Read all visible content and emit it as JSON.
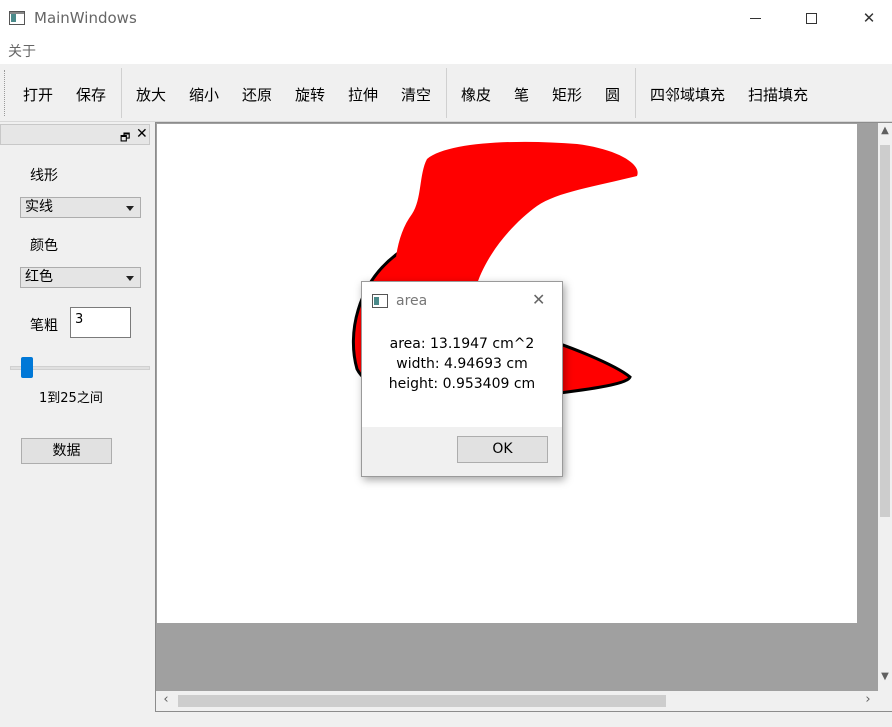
{
  "window": {
    "title": "MainWindows"
  },
  "menu": {
    "about": "关于"
  },
  "toolbar": {
    "open": "打开",
    "save": "保存",
    "zoom_in": "放大",
    "zoom_out": "缩小",
    "restore": "还原",
    "rotate": "旋转",
    "stretch": "拉伸",
    "clear": "清空",
    "eraser": "橡皮",
    "pen": "笔",
    "rect": "矩形",
    "circle": "圆",
    "fill4": "四邻域填充",
    "scan_fill": "扫描填充"
  },
  "dock": {
    "line_style_label": "线形",
    "line_style_value": "实线",
    "color_label": "颜色",
    "color_value": "红色",
    "width_label": "笔粗",
    "width_value": "3",
    "slider_level": 3,
    "slider_range": "1到25之间",
    "data_button": "数据"
  },
  "canvas": {
    "fill_color": "#ff0000",
    "outline_color": "#000000"
  },
  "dialog": {
    "title": "area",
    "area": "area: 13.1947 cm^2",
    "width": "width: 4.94693 cm",
    "height": "height: 0.953409 cm",
    "ok": "OK"
  },
  "colors": {
    "accent": "#0078d7",
    "canvas_bg": "#ffffff",
    "viewport_bg": "#a0a0a0"
  }
}
